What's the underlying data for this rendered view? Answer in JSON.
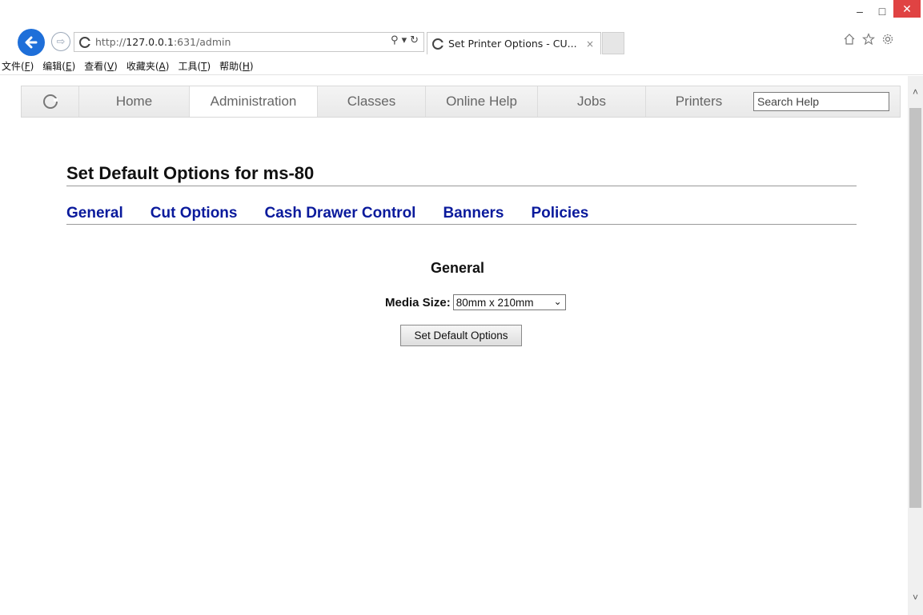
{
  "window": {
    "min_icon": "minimize-icon",
    "max_icon": "maximize-icon",
    "close_icon": "close-icon",
    "close_color": "#e04343"
  },
  "address_bar": {
    "url_prefix": "http://",
    "url_host": "127.0.0.1",
    "url_rest": ":631/admin",
    "search_icon": "search-icon",
    "refresh_icon": "refresh-icon"
  },
  "tab": {
    "title": "Set Printer Options - CU...",
    "close": "×"
  },
  "toolbar_icons": [
    "home-icon",
    "favorites-star-icon",
    "settings-gear-icon"
  ],
  "menu": [
    {
      "label": "文件(",
      "key": "F",
      "end": ")"
    },
    {
      "label": "编辑(",
      "key": "E",
      "end": ")"
    },
    {
      "label": "查看(",
      "key": "V",
      "end": ")"
    },
    {
      "label": "收藏夹(",
      "key": "A",
      "end": ")"
    },
    {
      "label": "工具(",
      "key": "T",
      "end": ")"
    },
    {
      "label": "帮助(",
      "key": "H",
      "end": ")"
    }
  ],
  "cups_nav": {
    "home": "Home",
    "administration": "Administration",
    "classes": "Classes",
    "online_help": "Online Help",
    "jobs": "Jobs",
    "printers": "Printers",
    "search_placeholder": "Search Help",
    "active": "Administration"
  },
  "page": {
    "title": "Set Default Options for ms-80",
    "sections": [
      "General",
      "Cut Options",
      "Cash Drawer Control",
      "Banners",
      "Policies"
    ],
    "section_heading": "General",
    "media_size_label": "Media Size:",
    "media_size_value": "80mm x 210mm",
    "submit_label": "Set Default Options",
    "link_color": "#0a1a9c"
  }
}
